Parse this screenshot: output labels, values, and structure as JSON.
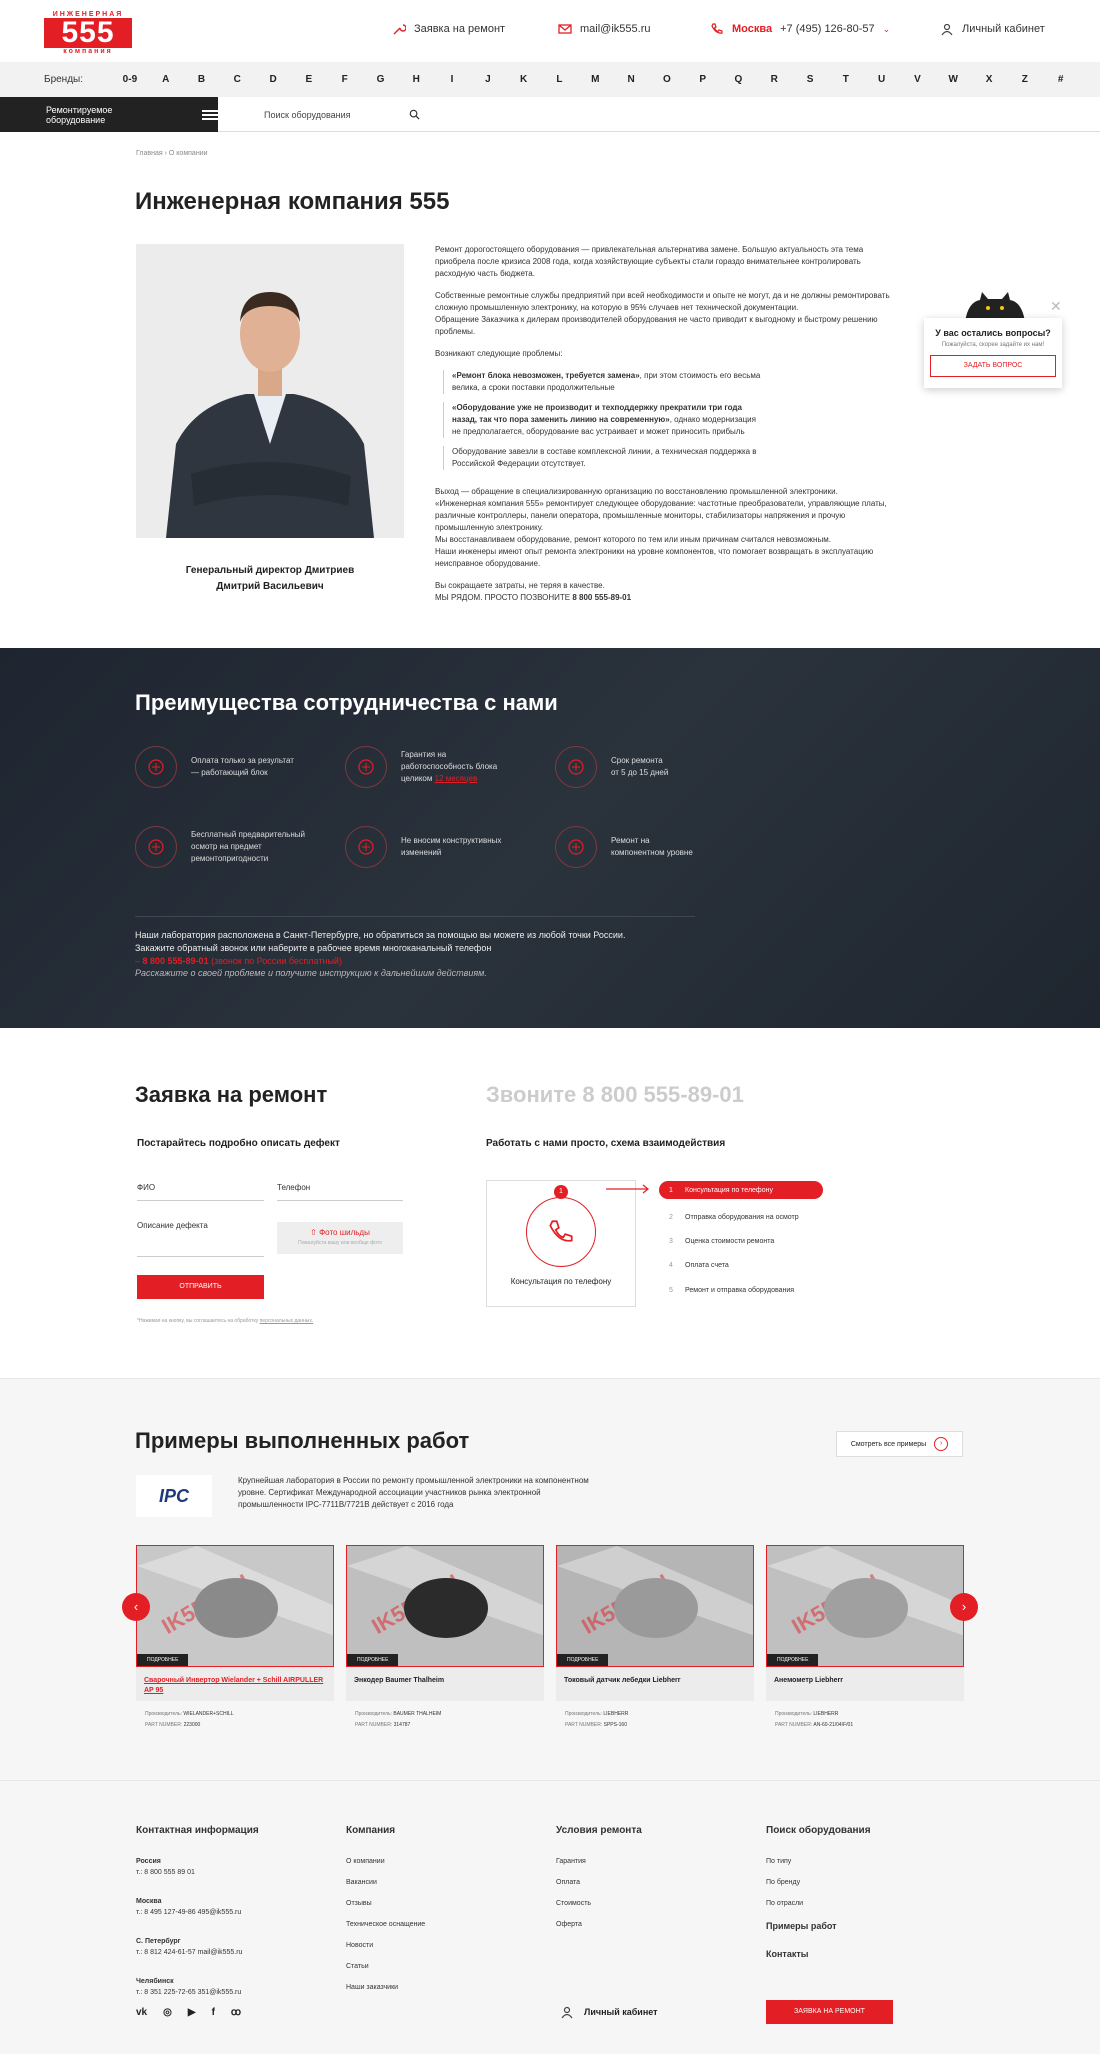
{
  "header": {
    "logo_top": "ИНЖЕНЕРНАЯ",
    "logo_num": "555",
    "logo_bottom": "компания",
    "repair_request": "Заявка на ремонт",
    "email": "mail@ik555.ru",
    "city": "Москва",
    "phone": "+7 (495) 126-80-57",
    "account": "Личный кабинет"
  },
  "brands": {
    "label": "Бренды:",
    "letters": [
      "0-9",
      "A",
      "B",
      "C",
      "D",
      "E",
      "F",
      "G",
      "H",
      "I",
      "J",
      "K",
      "L",
      "M",
      "N",
      "O",
      "P",
      "Q",
      "R",
      "S",
      "T",
      "U",
      "V",
      "W",
      "X",
      "Z",
      "#"
    ]
  },
  "nav": {
    "catalog": "Ремонтируемое оборудование",
    "search_placeholder": "Поиск оборудования"
  },
  "breadcrumb": {
    "home": "Главная",
    "sep": "›",
    "current": "О компании"
  },
  "page_title": "Инженерная компания 555",
  "director": {
    "line1": "Генеральный директор Дмитриев",
    "line2": "Дмитрий Васильевич"
  },
  "about": {
    "p1": "Ремонт дорогостоящего оборудования — привлекательная альтернатива замене. Большую актуальность эта тема приобрела после кризиса 2008 года, когда хозяйствующие субъекты стали гораздо внимательнее контролировать расходную часть бюджета.",
    "p2": "Собственные ремонтные службы предприятий при всей необходимости и опыте не могут, да и не должны ремонтировать сложную промышленную электронику, на которую в 95% случаев нет технической документации.",
    "p2b": "Обращение Заказчика к дилерам производителей оборудования не часто приводит к выгодному и быстрому решению проблемы.",
    "p3": "Возникают следующие проблемы:",
    "li1_b": "«Ремонт блока невозможен, требуется замена»",
    "li1": ", при этом стоимость его весьма велика, а сроки поставки продолжительные",
    "li2_b": "«Оборудование уже не производит и техподдержку прекратили три года назад, так что пора заменить линию на современную»",
    "li2": ", однако модернизация не предполагается, оборудование вас устраивает и может приносить прибыль",
    "li3": "Оборудование завезли в составе комплексной линии, а техническая поддержка в Российской Федерации отсутствует.",
    "p4": "Выход — обращение в специализированную организацию по восстановлению промышленной электроники.",
    "p4b": "«Инженерная компания 555» ремонтирует следующее оборудование: частотные преобразователи, управляющие платы, различные контроллеры, панели оператора, промышленные мониторы, стабилизаторы напряжения и прочую промышленную электронику.",
    "p4c": "Мы восстанавливаем оборудование, ремонт которого по тем или иным причинам считался невозможным.",
    "p4d": "Наши инженеры имеют опыт ремонта электроники на уровне компонентов, что помогает возвращать в эксплуатацию неисправное оборудование.",
    "p5": "Вы сокращаете затраты, не теряя в качестве.",
    "p5b": "МЫ РЯДОМ. ПРОСТО ПОЗВОНИТЕ",
    "p5_phone": "8 800 555-89-01"
  },
  "popup": {
    "question": "У вас остались вопросы?",
    "hint": "Пожалуйста, скорее задайте их нам!",
    "button": "ЗАДАТЬ ВОПРОС"
  },
  "advantages": {
    "title": "Преимущества сотрудничества с нами",
    "items": [
      {
        "text1": "Оплата только за результат",
        "text2": "— работающий блок",
        "text3": ""
      },
      {
        "text1": "Гарантия на",
        "text2": "работоспособность блока",
        "text3": "целиком",
        "link": "12 месяцев"
      },
      {
        "text1": "Срок ремонта",
        "text2": "от 5 до 15 дней",
        "text3": ""
      },
      {
        "text1": "Бесплатный предварительный",
        "text2": "осмотр на предмет",
        "text3": "ремонтопригодности"
      },
      {
        "text1": "Не вносим конструктивных",
        "text2": "изменений",
        "text3": ""
      },
      {
        "text1": "Ремонт на",
        "text2": "компонентном уровне",
        "text3": ""
      }
    ],
    "lab1": "Наши лаборатория расположена в Санкт-Петербурге, но обратиться за помощью вы можете из любой точки России.",
    "lab2": "Закажите обратный звонок или наберите в рабочее время многоканальный телефон",
    "lab_phone": "8 800 555-89-01",
    "lab_phone_note": "(звонок по России бесплатный)",
    "hint": "Расскажите о своей проблеме и получите инструкцию к дальнейшим действиям."
  },
  "repair": {
    "title": "Заявка на ремонт",
    "call": "Звоните 8 800 555-89-01",
    "describe": "Постарайтесь подробно описать дефект",
    "scheme": "Работать с нами просто, схема взаимодействия",
    "name_label": "ФИО",
    "phone_label": "Телефон",
    "defect_label": "Описание дефекта",
    "photo": "Фото шильды",
    "photo_hint": "Пожалуйста вашу или вообще фото",
    "send": "ОТПРАВИТЬ",
    "note": "*Нажимая на кнопку, вы соглашаетесь на обработку",
    "note_link": "персональных данных.",
    "step_num": "1",
    "step_title": "Консультация по телефону",
    "steps": [
      {
        "n": "1",
        "label": "Консультация по телефону"
      },
      {
        "n": "2",
        "label": "Отправка оборудования на осмотр"
      },
      {
        "n": "3",
        "label": "Оценка стоимости ремонта"
      },
      {
        "n": "4",
        "label": "Оплата счета"
      },
      {
        "n": "5",
        "label": "Ремонт и отправка оборудования"
      }
    ]
  },
  "works": {
    "title": "Примеры выполненных работ",
    "see_all": "Смотреть все примеры",
    "ipc_logo": "IPC",
    "ipc_text": "Крупнейшая лаборатория в России по ремонту промышленной электроники на компонентном уровне. Сертификат Международной ассоциации участников рынка электронной промышленности IPC-7711B/7721B действует с 2016 года",
    "tag": "ПОДРОБНЕЕ",
    "maker_label": "Производитель:",
    "pn_label": "PART NUMBER:",
    "cards": [
      {
        "title": "Сварочный Инвертор Wielander + Schill AIRPULLER AP 95",
        "maker": "WIELANDER+SCHILL",
        "pn": "223000"
      },
      {
        "title": "Энкодер Baumer Thalheim",
        "maker": "BAUMER THALHEIM",
        "pn": "314787"
      },
      {
        "title": "Токовый датчик лебедки Liebherr",
        "maker": "LIEBHERR",
        "pn": "SPPS-160"
      },
      {
        "title": "Анемометр Liebherr",
        "maker": "LIEBHERR",
        "pn": "AN-60-21/04/F/01"
      }
    ]
  },
  "footer": {
    "contacts_title": "Контактная информация",
    "contacts": [
      {
        "city": "Россия",
        "line": "т.: 8 800 555 89 01"
      },
      {
        "city": "Москва",
        "line": "т.: 8 495 127-49-86    495@ik555.ru"
      },
      {
        "city": "С. Петербург",
        "line": "т.: 8 812 424-61-57    mail@ik555.ru"
      },
      {
        "city": "Челябинск",
        "line": "т.: 8 351 225-72-65    351@ik555.ru"
      }
    ],
    "company_title": "Компания",
    "company": [
      "О компании",
      "Вакансии",
      "Отзывы",
      "Техническое оснащение",
      "Новости",
      "Статьи",
      "Наши заказчики"
    ],
    "terms_title": "Условия ремонта",
    "terms": [
      "Гарантия",
      "Оплата",
      "Стоимость",
      "Оферта"
    ],
    "search_title": "Поиск оборудования",
    "search": [
      "По типу",
      "По бренду",
      "По отрасли"
    ],
    "works_link": "Примеры работ",
    "contacts_link": "Контакты",
    "account": "Личный кабинет",
    "request": "ЗАЯВКА НА РЕМОНТ",
    "social": [
      "vk",
      "ok",
      "yt",
      "fb",
      "odn"
    ]
  }
}
